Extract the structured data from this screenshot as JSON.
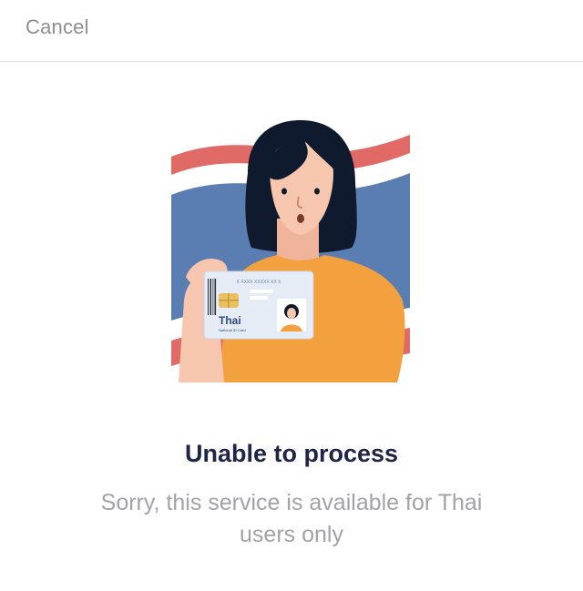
{
  "header": {
    "cancel_label": "Cancel"
  },
  "illustration": {
    "card_number_text": "X XXXX XXXXX XX X",
    "card_title": "Thai",
    "card_subtitle": "National ID Card",
    "colors": {
      "flag_red": "#df6a66",
      "flag_blue": "#5a7db2",
      "flag_white": "#ffffff",
      "hair": "#0f1a2e",
      "skin": "#f7c6ae",
      "shirt": "#f2a13e",
      "card_bg": "#e5ecf6",
      "chip": "#e8c061"
    }
  },
  "content": {
    "title": "Unable to process",
    "message": "Sorry, this service is available for Thai users only"
  }
}
